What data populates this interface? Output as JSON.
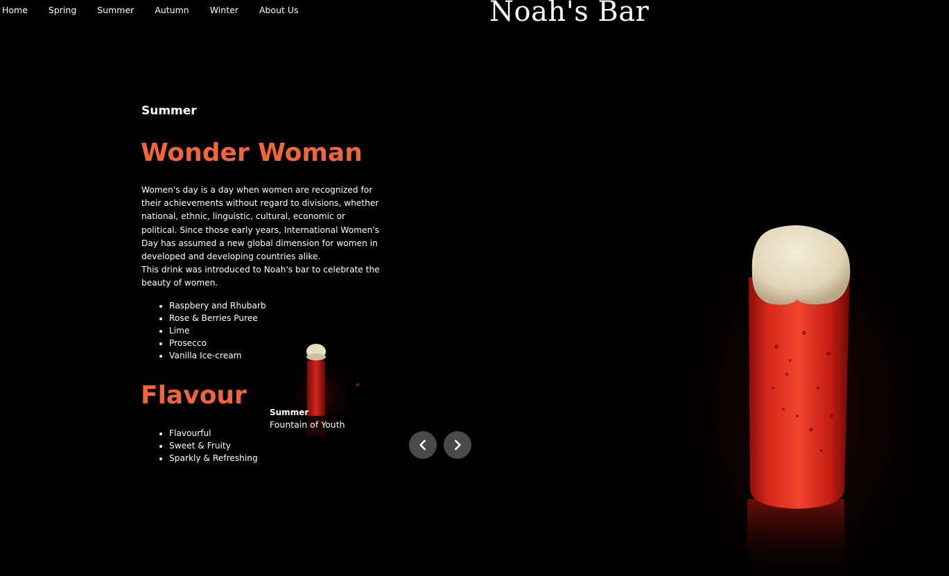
{
  "nav": {
    "items": [
      {
        "label": "Home"
      },
      {
        "label": "Spring"
      },
      {
        "label": "Summer"
      },
      {
        "label": "Autumn"
      },
      {
        "label": "Winter"
      },
      {
        "label": "About Us"
      }
    ]
  },
  "brand": "Noah's Bar",
  "drink": {
    "season": "Summer",
    "name": "Wonder Woman",
    "description": [
      "Women's day is a day when women are recognized for their achievements without regard to divisions, whether national, ethnic, linguistic, cultural, economic or political. Since those early years, International Women's Day has assumed a new global dimension for women in developed and developing countries alike.",
      "This drink was introduced to Noah's bar to celebrate the beauty of women."
    ],
    "ingredients": [
      "Raspbery and Rhubarb",
      "Rose & Berries Puree",
      "Lime",
      "Prosecco",
      "Vanilla Ice-cream"
    ],
    "flavour_title": "Flavour",
    "flavours": [
      "Flavourful",
      "Sweet & Fruity",
      "Sparkly & Refreshing"
    ]
  },
  "next_card": {
    "season": "Summer",
    "name": "Fountain of Youth"
  },
  "colors": {
    "accent": "#f0663a",
    "background": "#000000",
    "arrow_bg": "#4a4a4a"
  },
  "icons": {
    "prev": "chevron-left-icon",
    "next": "chevron-right-icon"
  }
}
